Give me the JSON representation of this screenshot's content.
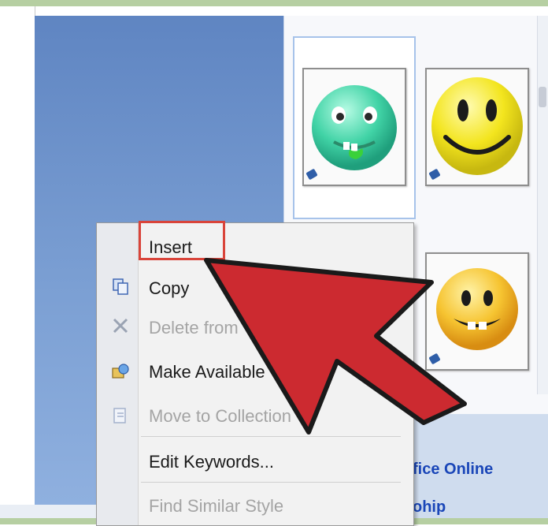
{
  "context_menu": {
    "items": [
      {
        "label": "Insert",
        "enabled": true,
        "highlighted": true
      },
      {
        "label": "Copy",
        "enabled": true,
        "icon": "copy-icon"
      },
      {
        "label": "Delete from",
        "enabled": false,
        "icon": "delete-x-icon"
      },
      {
        "label": "Make Available",
        "enabled": true,
        "icon": "make-available-icon"
      },
      {
        "label": "Move to Collection",
        "enabled": false,
        "icon": "move-collection-icon"
      },
      {
        "label": "Edit Keywords...",
        "enabled": true
      },
      {
        "label": "Find Similar Style",
        "enabled": false
      }
    ]
  },
  "gallery": {
    "clips": [
      {
        "name": "green-smiley-clip",
        "selected": true
      },
      {
        "name": "yellow-smiley-clip",
        "selected": false
      },
      {
        "name": "orange-smiley-clip",
        "selected": false
      }
    ],
    "links": [
      "fice Online",
      "ohip"
    ]
  },
  "colors": {
    "highlight_box": "#d9443a",
    "arrow": "#cc2a30",
    "link": "#1a46b8"
  }
}
